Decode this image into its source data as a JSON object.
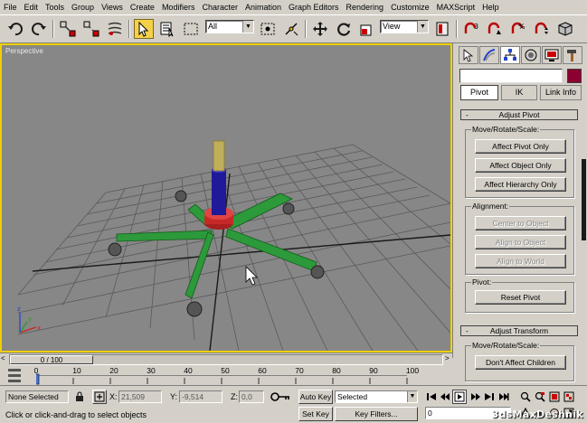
{
  "menubar": {
    "items": [
      "File",
      "Edit",
      "Tools",
      "Group",
      "Views",
      "Create",
      "Modifiers",
      "Character",
      "Animation",
      "Graph Editors",
      "Rendering",
      "Customize",
      "MAXScript",
      "Help"
    ]
  },
  "toolbar": {
    "selection_filter": "All",
    "reference_coord": "View"
  },
  "viewport": {
    "label": "Perspective",
    "axis_labels": {
      "x": "x",
      "y": "y",
      "z": "z"
    }
  },
  "command_panel": {
    "tabs": [
      "create-icon",
      "modify-icon",
      "hierarchy-icon",
      "motion-icon",
      "display-icon",
      "utilities-icon"
    ],
    "active_tab": "hierarchy",
    "object_name": "",
    "object_color": "#8b0030",
    "subtabs": {
      "pivot": "Pivot",
      "ik": "IK",
      "link_info": "Link Info"
    },
    "adjust_pivot": {
      "title": "Adjust Pivot",
      "toggle": "-",
      "move_group_label": "Move/Rotate/Scale:",
      "affect_pivot_only": "Affect Pivot Only",
      "affect_object_only": "Affect Object Only",
      "affect_hierarchy_only": "Affect Hierarchy Only",
      "alignment_group_label": "Alignment:",
      "center_to_object": "Center to Object",
      "align_to_object": "Align to Object",
      "align_to_world": "Align to World",
      "pivot_group_label": "Pivot:",
      "reset_pivot": "Reset Pivot"
    },
    "adjust_transform": {
      "title": "Adjust Transform",
      "toggle": "-",
      "move_group_label": "Move/Rotate/Scale:",
      "dont_affect_children": "Don't Affect Children"
    }
  },
  "timeline": {
    "slider_text": "0 / 100",
    "ruler_ticks": [
      "0",
      "10",
      "20",
      "30",
      "40",
      "50",
      "60",
      "70",
      "80",
      "90",
      "100"
    ]
  },
  "status": {
    "selection": "None Selected",
    "x_label": "X:",
    "x_value": "21,509",
    "y_label": "Y:",
    "y_value": "-9,514",
    "z_label": "Z:",
    "z_value": "0,0",
    "prompt": "Click or click-and-drag to select objects",
    "auto_key": "Auto Key",
    "set_key": "Set Key",
    "key_mode": "Selected",
    "key_filters": "Key Filters...",
    "current_frame": "0"
  },
  "watermark": "3dsMaxDeshnik"
}
